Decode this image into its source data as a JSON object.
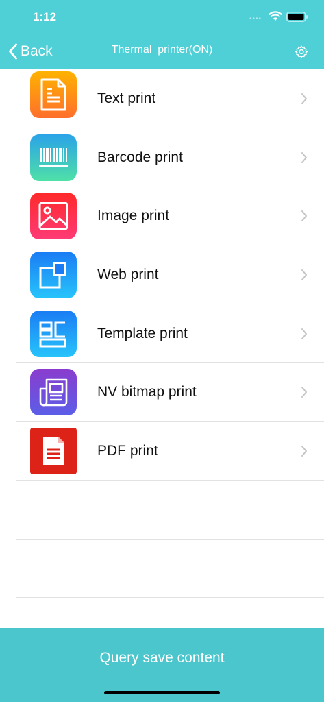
{
  "status": {
    "time": "1:12",
    "signal": "••••"
  },
  "nav": {
    "back_label": "Back",
    "title": "Thermal  printer(ON)",
    "settings_icon": "gear-icon"
  },
  "items": [
    {
      "label": "Text print",
      "icon": "document-icon",
      "gradient": [
        "#ffb300",
        "#ff6f2c"
      ]
    },
    {
      "label": "Barcode print",
      "icon": "barcode-icon",
      "gradient": [
        "#2aa3e8",
        "#4fe0a8"
      ]
    },
    {
      "label": "Image print",
      "icon": "image-icon",
      "gradient": [
        "#ff2a2a",
        "#ff3a76"
      ]
    },
    {
      "label": "Web print",
      "icon": "window-icon",
      "gradient": [
        "#1a7cf4",
        "#27c4fb"
      ]
    },
    {
      "label": "Template print",
      "icon": "template-icon",
      "gradient": [
        "#1a7cf4",
        "#27c4fb"
      ]
    },
    {
      "label": "NV bitmap print",
      "icon": "newspaper-icon",
      "gradient": [
        "#8a3ccd",
        "#5b5ee8"
      ]
    },
    {
      "label": "PDF print",
      "icon": "pdf-icon",
      "gradient": [
        "#e3261c",
        "#d8211a"
      ]
    }
  ],
  "bottom_button": {
    "label": "Query save content"
  },
  "colors": {
    "header": "#4fcfd6",
    "bottom": "#4cc6cd"
  }
}
